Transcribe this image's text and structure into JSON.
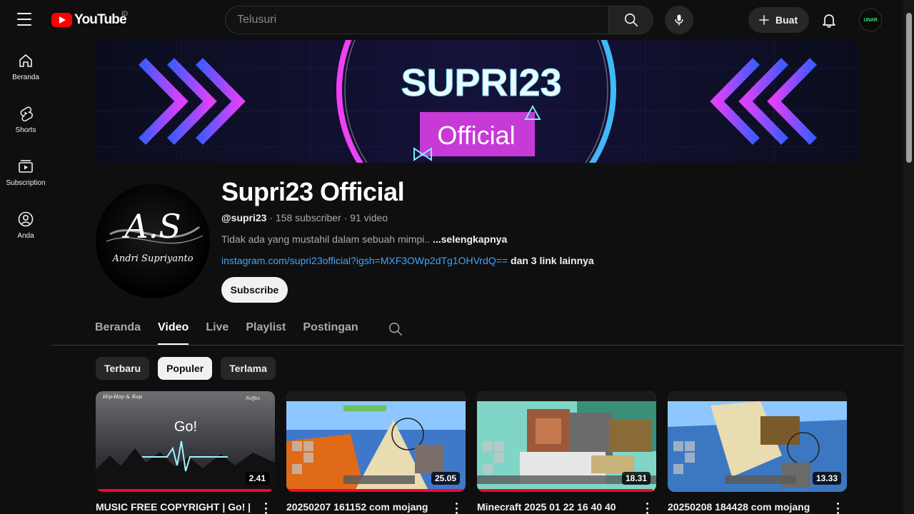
{
  "header": {
    "logo_text": "YouTube",
    "country_code": "ID",
    "search_placeholder": "Telusuri",
    "create_label": "Buat",
    "avatar_text": "UNAR"
  },
  "sidebar": {
    "items": [
      {
        "label": "Beranda",
        "icon": "home-icon"
      },
      {
        "label": "Shorts",
        "icon": "shorts-icon"
      },
      {
        "label": "Subscription",
        "icon": "subscriptions-icon"
      },
      {
        "label": "Anda",
        "icon": "you-icon"
      }
    ]
  },
  "banner": {
    "title": "SUPRI23",
    "subtitle": "Official"
  },
  "channel": {
    "name": "Supri23 Official",
    "handle": "@supri23",
    "stats": " · 158 subscriber · 91 video",
    "description": "Tidak ada yang mustahil dalam sebuah mimpi.. ",
    "description_more": "...selengkapnya",
    "link_url": "instagram.com/supri23official?igsh=MXF3OWp2dTg1OHVrdQ==",
    "link_more": " dan 3 link lainnya",
    "subscribe_label": "Subscribe",
    "avatar_initials": "A.S",
    "avatar_signature": "Andri Supriyanto"
  },
  "tabs": [
    {
      "label": "Beranda",
      "active": false
    },
    {
      "label": "Video",
      "active": true
    },
    {
      "label": "Live",
      "active": false
    },
    {
      "label": "Playlist",
      "active": false
    },
    {
      "label": "Postingan",
      "active": false
    }
  ],
  "chips": [
    {
      "label": "Terbaru",
      "active": false
    },
    {
      "label": "Populer",
      "active": true
    },
    {
      "label": "Terlama",
      "active": false
    }
  ],
  "videos": [
    {
      "title": "MUSIC FREE COPYRIGHT | Go! |",
      "duration": "2.41",
      "thumb_text": "Go!",
      "thumb_tag": "Hip-Hop & Rap",
      "thumb_brand": "Neffex",
      "watched": 0.98
    },
    {
      "title": "20250207 161152 com mojang",
      "duration": "25.05",
      "watched": 1.0
    },
    {
      "title": "Minecraft 2025 01 22 16 40 40",
      "duration": "18.31",
      "watched": 0.98
    },
    {
      "title": "20250208 184428 com mojang",
      "duration": "13.33",
      "watched": 0.0
    }
  ],
  "colors": {
    "brand_red": "#ff0000",
    "progress_red": "#ff0033",
    "link_blue": "#3ea6ff",
    "banner_magenta": "#e040fb",
    "banner_cyan": "#40c4ff"
  }
}
